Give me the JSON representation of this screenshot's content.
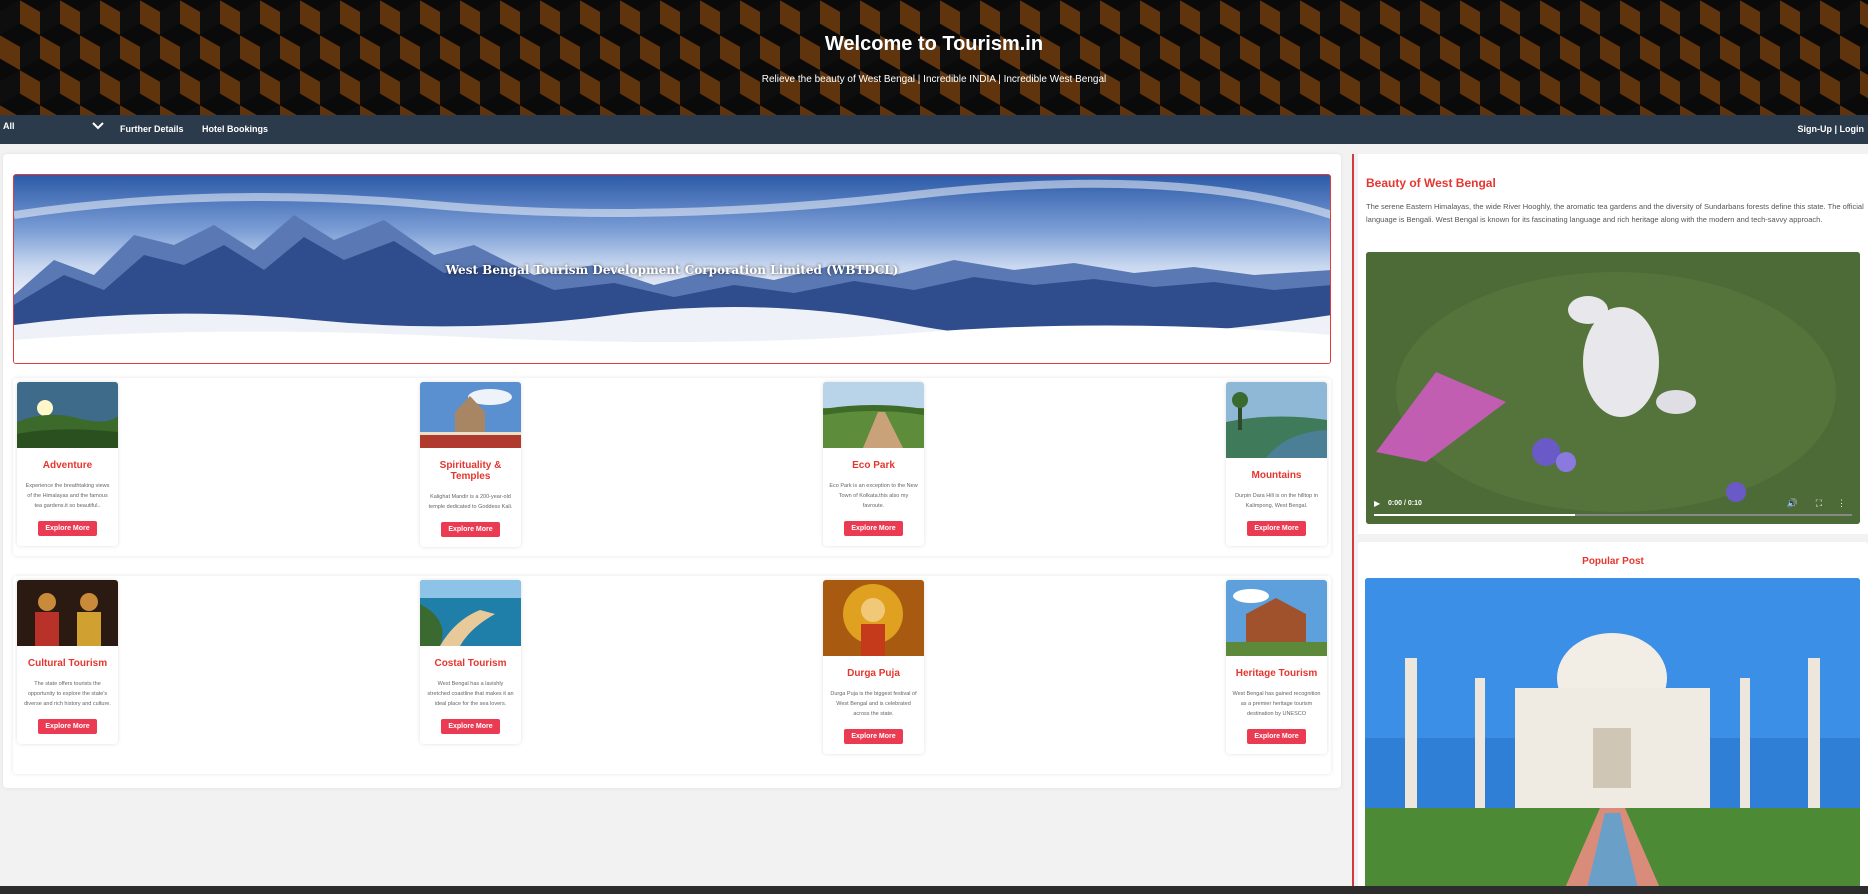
{
  "header": {
    "title": "Welcome to Tourism.in",
    "subtitle": "Relieve the beauty of West Bengal | Incredible INDIA | Incredible West Bengal"
  },
  "nav": {
    "select_value": "All",
    "links": [
      "Further Details",
      "Hotel Bookings"
    ],
    "auth": "Sign-Up | Login"
  },
  "banner": {
    "text": "West Bengal Tourism Development Corporation Limited (WBTDCL)"
  },
  "cards": [
    {
      "title": "Adventure",
      "desc": "Experience the breathtaking views of the Himalayas and the famous tea gardens.it so beautiful..",
      "button": "Explore More"
    },
    {
      "title": "Spirituality & Temples",
      "desc": "Kalighat Mandir is a 200-year-old temple dedicated to Goddess Kali.",
      "button": "Explore More"
    },
    {
      "title": "Eco Park",
      "desc": "Eco Park is an exception to the New Town of Kolkata.this also my favroute.",
      "button": "Explore More"
    },
    {
      "title": "Mountains",
      "desc": "Durpin Dara Hill is on the hilltop in Kalimpong, West Bengal.",
      "button": "Explore More"
    },
    {
      "title": "Cultural Tourism",
      "desc": "The state offers tourists the opportunity to explore the state's diverse and rich history and culture.",
      "button": "Explore More"
    },
    {
      "title": "Costal Tourism",
      "desc": "West Bengal has a lavishly stretched coastline that makes it an ideal place for the sea lovers.",
      "button": "Explore More"
    },
    {
      "title": "Durga Puja",
      "desc": "Durga Puja is the biggest festival of West Bengal and is celebrated across the state.",
      "button": "Explore More"
    },
    {
      "title": "Heritage Tourism",
      "desc": "West Bengal has gained recognition as a premier heritage tourism destination by UNESCO",
      "button": "Explore More"
    }
  ],
  "sidebar": {
    "title": "Beauty of West Bengal",
    "text": "The serene Eastern Himalayas, the wide River Hooghly, the aromatic tea gardens and the diversity of Sundarbans forests define this state. The official language is Bengali. West Bengal is known for its fascinating language and rich heritage along with the modern and tech-savvy approach.",
    "video_time": "0:00 / 0:10",
    "video_progress": 0.42,
    "popular_title": "Popular Post"
  },
  "colors": {
    "accent": "#e5362f",
    "button": "#ea3b53",
    "nav_bg": "#2c3b4b"
  }
}
